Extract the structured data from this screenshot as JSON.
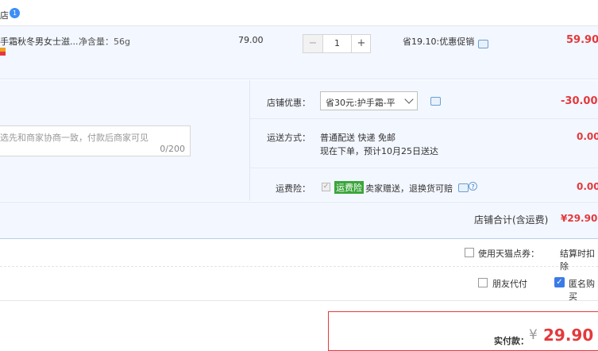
{
  "header": {
    "shop_partial": "店",
    "shop_badge": "1"
  },
  "item": {
    "title": "手霜秋冬男女士滋...",
    "spec": "净含量：56g",
    "price": "79.00",
    "qty": "1",
    "qty_minus": "−",
    "qty_plus": "+",
    "promo": "省19.10:优惠促销",
    "total": "59.90"
  },
  "note": {
    "placeholder": "选先和商家协商一致，付款后商家可见",
    "counter": "0/200"
  },
  "coupon": {
    "label": "店铺优惠：",
    "selected": "省30元:护手霜-平",
    "amount": "-30.00"
  },
  "shipping": {
    "label": "运送方式：",
    "method": "普通配送 快递 免邮",
    "eta": "现在下单，预计10月25日送达",
    "amount": "0.00"
  },
  "insurance": {
    "label": "运费险：",
    "badge": "运费险",
    "desc": "卖家赠送，退换货可赔",
    "amount": "0.00"
  },
  "subtotal": {
    "label": "店铺合计(含运费)",
    "amount": "¥29.90"
  },
  "options": {
    "tmall_points": "使用天猫点券：",
    "tmall_points_right": "结算时扣除",
    "friend_pay": "朋友代付",
    "anonymous": "匿名购买"
  },
  "pay": {
    "label": "实付款：",
    "currency": "¥",
    "amount": "29.90"
  },
  "colors": {
    "accent_red": "#e4393c",
    "panel_blue": "#f3f7ff",
    "checkbox_blue": "#3b7be6",
    "badge_green": "#3aa53a"
  },
  "icons": [
    "notification-badge",
    "chat-icon",
    "help-icon",
    "checkbox-icon",
    "dropdown-chevron-icon"
  ]
}
